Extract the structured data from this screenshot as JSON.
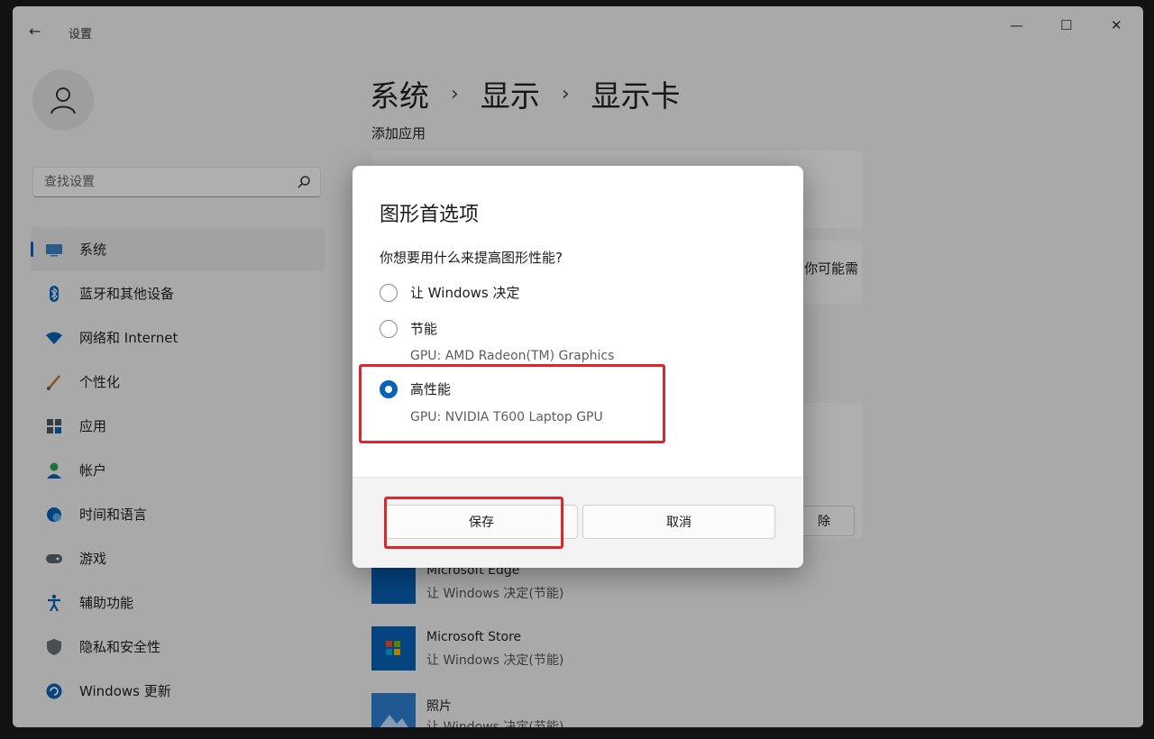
{
  "window": {
    "title": "设置",
    "back_icon": "back-arrow-icon",
    "minimize": "—",
    "maximize": "☐",
    "close": "✕"
  },
  "search": {
    "placeholder": "查找设置"
  },
  "sidebar": {
    "items": [
      {
        "label": "系统",
        "icon": "display-icon",
        "color": "#0a62b8"
      },
      {
        "label": "蓝牙和其他设备",
        "icon": "bluetooth-icon",
        "color": "#0a62b8"
      },
      {
        "label": "网络和 Internet",
        "icon": "wifi-icon",
        "color": "#0a62b8"
      },
      {
        "label": "个性化",
        "icon": "brush-icon",
        "color": "#c77a2c"
      },
      {
        "label": "应用",
        "icon": "apps-icon",
        "color": "#4a5560"
      },
      {
        "label": "帐户",
        "icon": "account-icon",
        "color": "#2ca05a"
      },
      {
        "label": "时间和语言",
        "icon": "globe-clock-icon",
        "color": "#0a62b8"
      },
      {
        "label": "游戏",
        "icon": "gamepad-icon",
        "color": "#5a6470"
      },
      {
        "label": "辅助功能",
        "icon": "accessibility-icon",
        "color": "#0a62b8"
      },
      {
        "label": "隐私和安全性",
        "icon": "shield-icon",
        "color": "#6a7178"
      },
      {
        "label": "Windows 更新",
        "icon": "update-icon",
        "color": "#0a62b8"
      }
    ]
  },
  "breadcrumb": {
    "part1": "系统",
    "part2": "显示",
    "part3": "显示卡",
    "sep": "›"
  },
  "main": {
    "section_label": "添加应用",
    "right_partial_text": "你可能需",
    "right_partial_button": "除",
    "apps": [
      {
        "name": "Microsoft Edge",
        "pref": "让 Windows 决定(节能)"
      },
      {
        "name": "Microsoft Store",
        "pref": "让 Windows 决定(节能)"
      },
      {
        "name": "照片",
        "pref": "让 Windows 决定(节能)"
      }
    ]
  },
  "dialog": {
    "title": "图形首选项",
    "question": "你想要用什么来提高图形性能?",
    "options": [
      {
        "label": "让 Windows 决定",
        "sub": "",
        "checked": false
      },
      {
        "label": "节能",
        "sub": "GPU: AMD Radeon(TM) Graphics",
        "checked": false
      },
      {
        "label": "高性能",
        "sub": "GPU: NVIDIA T600 Laptop GPU",
        "checked": true
      }
    ],
    "save_label": "保存",
    "cancel_label": "取消",
    "accent": "#0a62b8",
    "highlight_color": "#d9272e"
  }
}
